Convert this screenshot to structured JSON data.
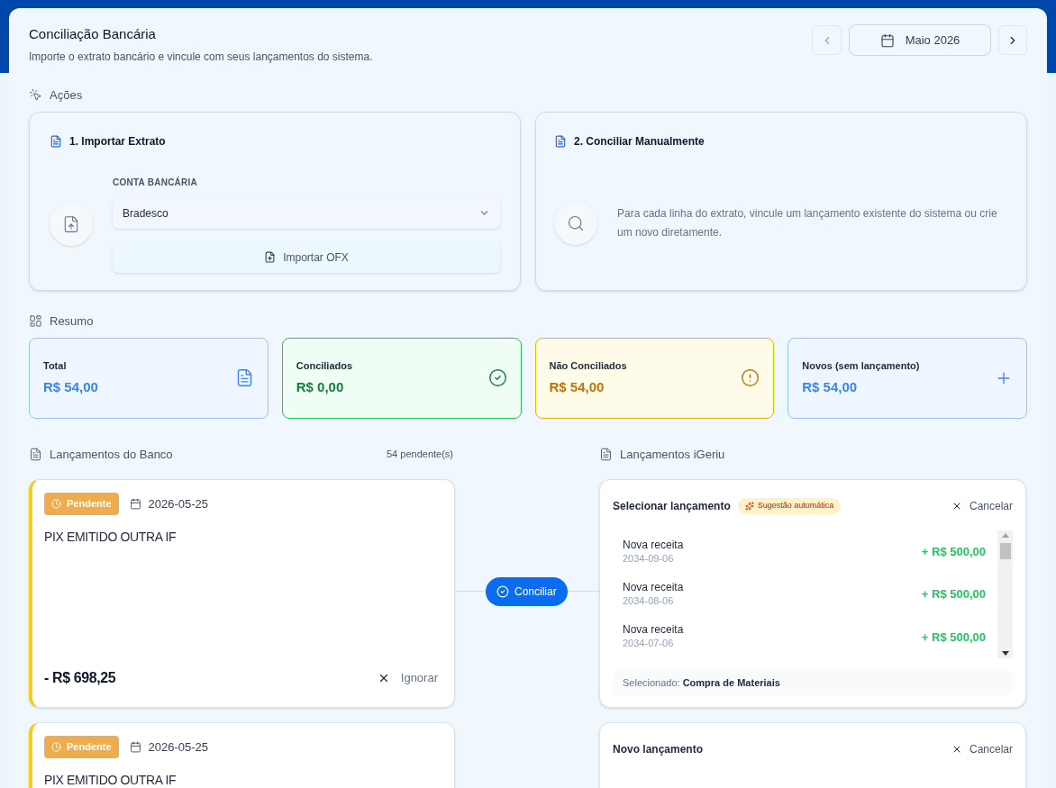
{
  "header": {
    "title": "Conciliação Bancária",
    "subtitle": "Importe o extrato bancário e vincule com seus lançamentos do sistema.",
    "month": "Maio 2026"
  },
  "actions": {
    "label": "Ações",
    "import_card": {
      "title": "1. Importar Extrato",
      "account_label": "CONTA BANCÁRIA",
      "account_value": "Bradesco",
      "button": "Importar OFX"
    },
    "manual_card": {
      "title": "2. Conciliar Manualmente",
      "text": "Para cada linha do extrato, vincule um lançamento existente do sistema ou crie um novo diretamente."
    }
  },
  "summary": {
    "label": "Resumo",
    "cards": [
      {
        "kind": "total",
        "label": "Total",
        "value": "R$ 54,00"
      },
      {
        "kind": "reconciled",
        "label": "Conciliados",
        "value": "R$ 0,00"
      },
      {
        "kind": "pending",
        "label": "Não Conciliados",
        "value": "R$ 54,00"
      },
      {
        "kind": "new",
        "label": "Novos (sem lançamento)",
        "value": "R$ 54,00"
      }
    ]
  },
  "bank": {
    "title": "Lançamentos do Banco",
    "count": "54 pendente(s)",
    "entries": [
      {
        "status": "Pendente",
        "date": "2026-05-25",
        "description": "PIX EMITIDO OUTRA IF",
        "amount": "- R$ 698,25",
        "ignore": "Ignorar"
      },
      {
        "status": "Pendente",
        "date": "2026-05-25",
        "description": "PIX EMITIDO OUTRA IF"
      }
    ]
  },
  "reconcile_button": "Conciliar",
  "system": {
    "title": "Lançamentos iGeriu",
    "panels": [
      {
        "kind": "select",
        "title": "Selecionar lançamento",
        "badge": "Sugestão automática",
        "cancel": "Cancelar",
        "items": [
          {
            "name": "Nova receita",
            "date": "2034-09-06",
            "amount": "+ R$ 500,00"
          },
          {
            "name": "Nova receita",
            "date": "2034-08-06",
            "amount": "+ R$ 500,00"
          },
          {
            "name": "Nova receita",
            "date": "2034-07-06",
            "amount": "+ R$ 500,00"
          }
        ],
        "selected_text": "Selecionado: **Compra de Materiais**"
      },
      {
        "kind": "new",
        "title": "Novo lançamento",
        "cancel": "Cancelar"
      }
    ]
  }
}
